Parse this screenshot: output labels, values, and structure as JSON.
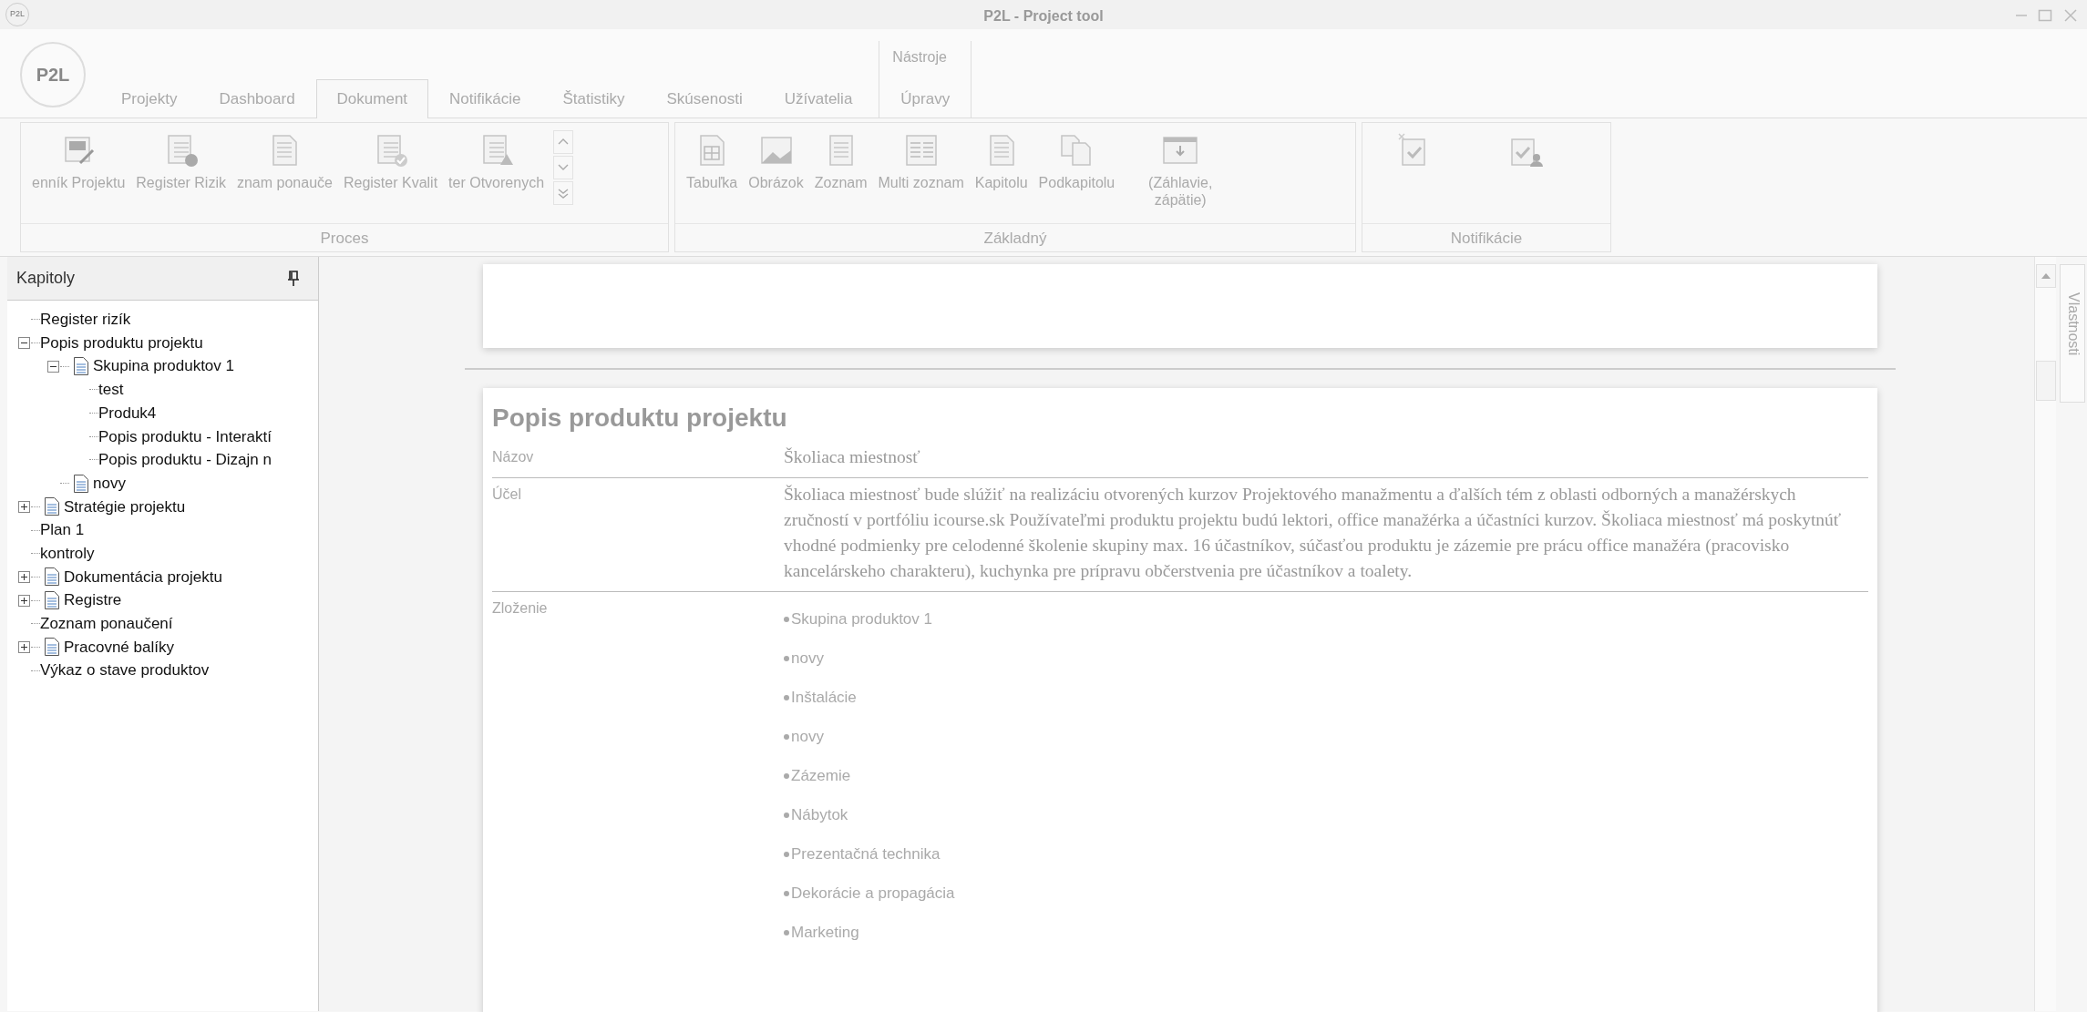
{
  "window": {
    "title": "P2L - Project tool",
    "logo": "P2L"
  },
  "app_logo": "P2L",
  "tabs": [
    {
      "label": "Projekty",
      "selected": false
    },
    {
      "label": "Dashboard",
      "selected": false
    },
    {
      "label": "Dokument",
      "selected": true
    },
    {
      "label": "Notifikácie",
      "selected": false
    },
    {
      "label": "Štatistiky",
      "selected": false
    },
    {
      "label": "Skúsenosti",
      "selected": false
    },
    {
      "label": "Užívatelia",
      "selected": false
    }
  ],
  "context_tab": {
    "header": "Nástroje",
    "label": "Úpravy",
    "selected": false
  },
  "ribbon": {
    "groups": [
      {
        "title": "Proces",
        "scroller": true,
        "buttons": [
          {
            "kind": "diary",
            "label": "enník Projektu"
          },
          {
            "kind": "risk",
            "label": "Register Rizik"
          },
          {
            "kind": "lessons",
            "label": "znam ponauče"
          },
          {
            "kind": "quality",
            "label": "Register Kvalit"
          },
          {
            "kind": "issues",
            "label": "ter Otvorenych"
          }
        ]
      },
      {
        "title": "Základný",
        "scroller": false,
        "buttons": [
          {
            "kind": "table",
            "label": "Tabuľka"
          },
          {
            "kind": "image",
            "label": "Obrázok"
          },
          {
            "kind": "list",
            "label": "Zoznam"
          },
          {
            "kind": "multilist",
            "label": "Multi zoznam"
          },
          {
            "kind": "page",
            "label": "Kapitolu"
          },
          {
            "kind": "pages",
            "label": "Podkapitolu"
          },
          {
            "kind": "header",
            "label": "(Záhlavie, zápätie)"
          }
        ]
      },
      {
        "title": "Notifikácie",
        "scroller": false,
        "buttons": [
          {
            "kind": "clipboard-new"
          },
          {
            "kind": "clipboard-user"
          }
        ]
      }
    ]
  },
  "side_panel": {
    "title": "Kapitoly"
  },
  "tree": [
    {
      "label": "Register rizík",
      "kind": "plain"
    },
    {
      "label": "Popis produktu projektu",
      "kind": "plain",
      "expanded": true,
      "children": [
        {
          "label": "Skupina produktov 1",
          "kind": "document",
          "expanded": true,
          "children": [
            {
              "label": "test",
              "kind": "plain"
            },
            {
              "label": "Produk4",
              "kind": "plain"
            },
            {
              "label": "Popis produktu - Interaktí",
              "kind": "plain"
            },
            {
              "label": "Popis produktu - Dizajn n",
              "kind": "plain"
            }
          ]
        },
        {
          "label": "novy",
          "kind": "document"
        }
      ]
    },
    {
      "label": "Stratégie projektu",
      "kind": "document",
      "expanded": false
    },
    {
      "label": "Plan 1",
      "kind": "plain"
    },
    {
      "label": "kontroly",
      "kind": "plain"
    },
    {
      "label": "Dokumentácia projektu",
      "kind": "document",
      "expanded": false
    },
    {
      "label": "Registre",
      "kind": "document",
      "expanded": false
    },
    {
      "label": "Zoznam ponaučení",
      "kind": "plain"
    },
    {
      "label": "Pracovné balíky",
      "kind": "document",
      "expanded": false
    },
    {
      "label": "Výkaz o stave produktov",
      "kind": "plain"
    }
  ],
  "document": {
    "title": "Popis produktu projektu",
    "fields": [
      {
        "label": "Názov",
        "kind": "text",
        "value": "Školiaca miestnosť"
      },
      {
        "label": "Účel",
        "kind": "text",
        "value": "Školiaca miestnosť bude slúžiť na realizáciu otvorených kurzov Projektového manažmentu a ďalších tém z oblasti odborných a manažérskych zručností v portfóliu icourse.sk Používateľmi produktu projektu budú lektori, office manažérka a účastníci kurzov. Školiaca miestnosť má poskytnúť vhodné podmienky pre celodenné školenie skupiny max. 16 účastníkov, súčasťou produktu je zázemie pre prácu office manažéra (pracovisko kancelárskeho charakteru), kuchynka pre prípravu občerstvenia pre účastníkov a toalety."
      },
      {
        "label": "Zloženie",
        "kind": "list",
        "items": [
          "Skupina produktov 1",
          "novy",
          "Inštalácie",
          "novy",
          "Zázemie",
          "Nábytok",
          "Prezentačná technika",
          "Dekorácie a propagácia",
          "Marketing"
        ]
      }
    ]
  },
  "properties_tab": {
    "label": "Vlastnosti"
  }
}
